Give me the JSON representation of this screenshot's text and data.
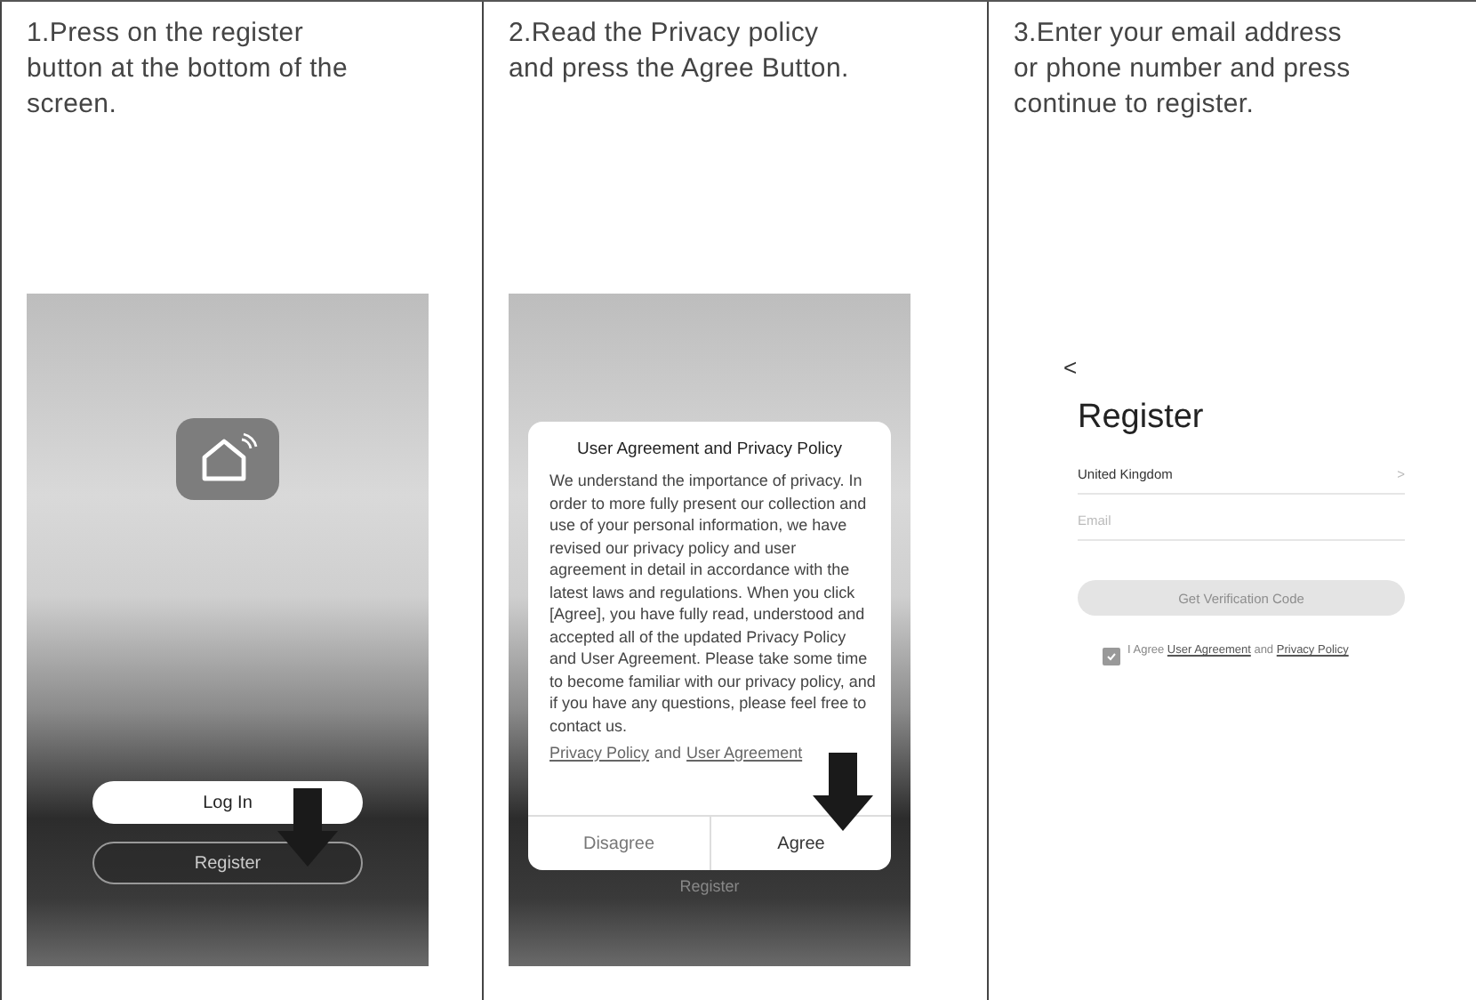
{
  "steps": [
    {
      "kind": "welcome",
      "instruction": "1.Press on the register button at the bottom of the screen.",
      "screen": {
        "buttons": [
          {
            "label": "Log In",
            "kind": "primary",
            "pointed": false
          },
          {
            "label": "Register",
            "kind": "outline",
            "pointed": true
          }
        ]
      }
    },
    {
      "kind": "dialog",
      "instruction": "2.Read the Privacy policy and press the Agree Button.",
      "screen": {
        "behind_button": "Register",
        "dialog": {
          "title": "User Agreement and Privacy Policy",
          "body": "We understand the importance of privacy. In order to more fully present our collection and use of your personal information, we have revised our privacy policy and user agreement in detail in accordance with the latest laws and regulations. When you click [Agree], you have fully read, understood and accepted all of the updated Privacy Policy and User Agreement. Please take some time to become familiar with our privacy policy, and if you have any questions, please feel free to contact us.",
          "links": [
            "Privacy Policy",
            "User Agreement"
          ],
          "joiner": "and",
          "buttons": [
            {
              "label": "Disagree",
              "pointed": false
            },
            {
              "label": "Agree",
              "pointed": true
            }
          ]
        }
      }
    },
    {
      "kind": "register",
      "instruction": "3.Enter your email address or phone number and press continue to register.",
      "screen": {
        "back": "<",
        "title": "Register",
        "country": "United Kingdom",
        "chevron": ">",
        "email_placeholder": "Email",
        "submit": {
          "label": "Get Verification Code",
          "disabled": true
        },
        "agree": {
          "checked": true,
          "text": "I Agree",
          "links": [
            "User Agreement",
            "Privacy Policy"
          ],
          "joiner": "and"
        }
      }
    }
  ]
}
